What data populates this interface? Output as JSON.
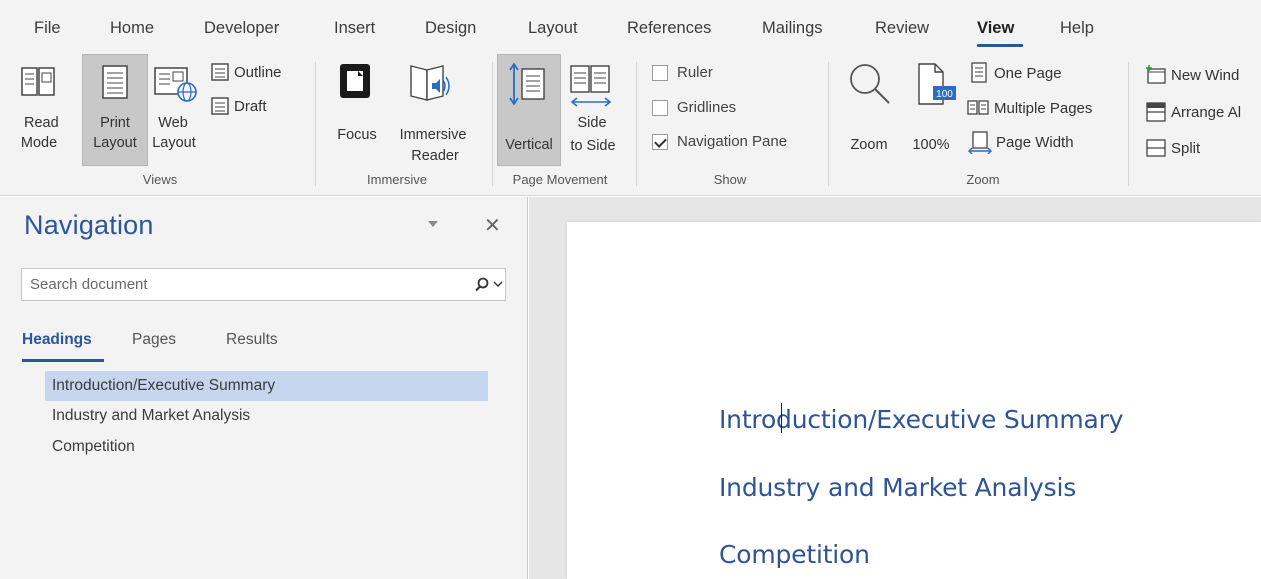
{
  "ribbon_tabs": [
    "File",
    "Home",
    "Developer",
    "Insert",
    "Design",
    "Layout",
    "References",
    "Mailings",
    "Review",
    "View",
    "Help"
  ],
  "active_tab": "View",
  "ribbon": {
    "views": {
      "read_mode": [
        "Read",
        "Mode"
      ],
      "print_layout": [
        "Print",
        "Layout"
      ],
      "web_layout": [
        "Web",
        "Layout"
      ],
      "outline": "Outline",
      "draft": "Draft",
      "group_label": "Views"
    },
    "immersive": {
      "focus": "Focus",
      "immersive_reader": [
        "Immersive",
        "Reader"
      ],
      "group_label": "Immersive"
    },
    "page_movement": {
      "vertical": "Vertical",
      "side_to_side": [
        "Side",
        "to Side"
      ],
      "group_label": "Page Movement"
    },
    "show": {
      "ruler": "Ruler",
      "gridlines": "Gridlines",
      "navigation_pane": "Navigation Pane",
      "ruler_checked": false,
      "gridlines_checked": false,
      "navigation_pane_checked": true,
      "group_label": "Show"
    },
    "zoom": {
      "zoom": "Zoom",
      "hundred_percent": "100%",
      "hundred_badge": "100",
      "one_page": "One Page",
      "multiple_pages": "Multiple Pages",
      "page_width": "Page Width",
      "group_label": "Zoom"
    },
    "window": {
      "new_window": "New Wind",
      "arrange_all": "Arrange Al",
      "split": "Split"
    }
  },
  "navigation": {
    "title": "Navigation",
    "search_placeholder": "Search document",
    "tabs": [
      "Headings",
      "Pages",
      "Results"
    ],
    "active_tab": "Headings",
    "headings": [
      "Introduction/Executive Summary",
      "Industry and Market Analysis",
      "Competition"
    ],
    "selected_heading": "Introduction/Executive Summary"
  },
  "document": {
    "headings": [
      "Introduction/Executive Summary",
      "Industry and Market Analysis",
      "Competition"
    ]
  },
  "colors": {
    "accent": "#2b579a",
    "heading_text": "#2f5496",
    "selection": "#c5d6ee"
  }
}
